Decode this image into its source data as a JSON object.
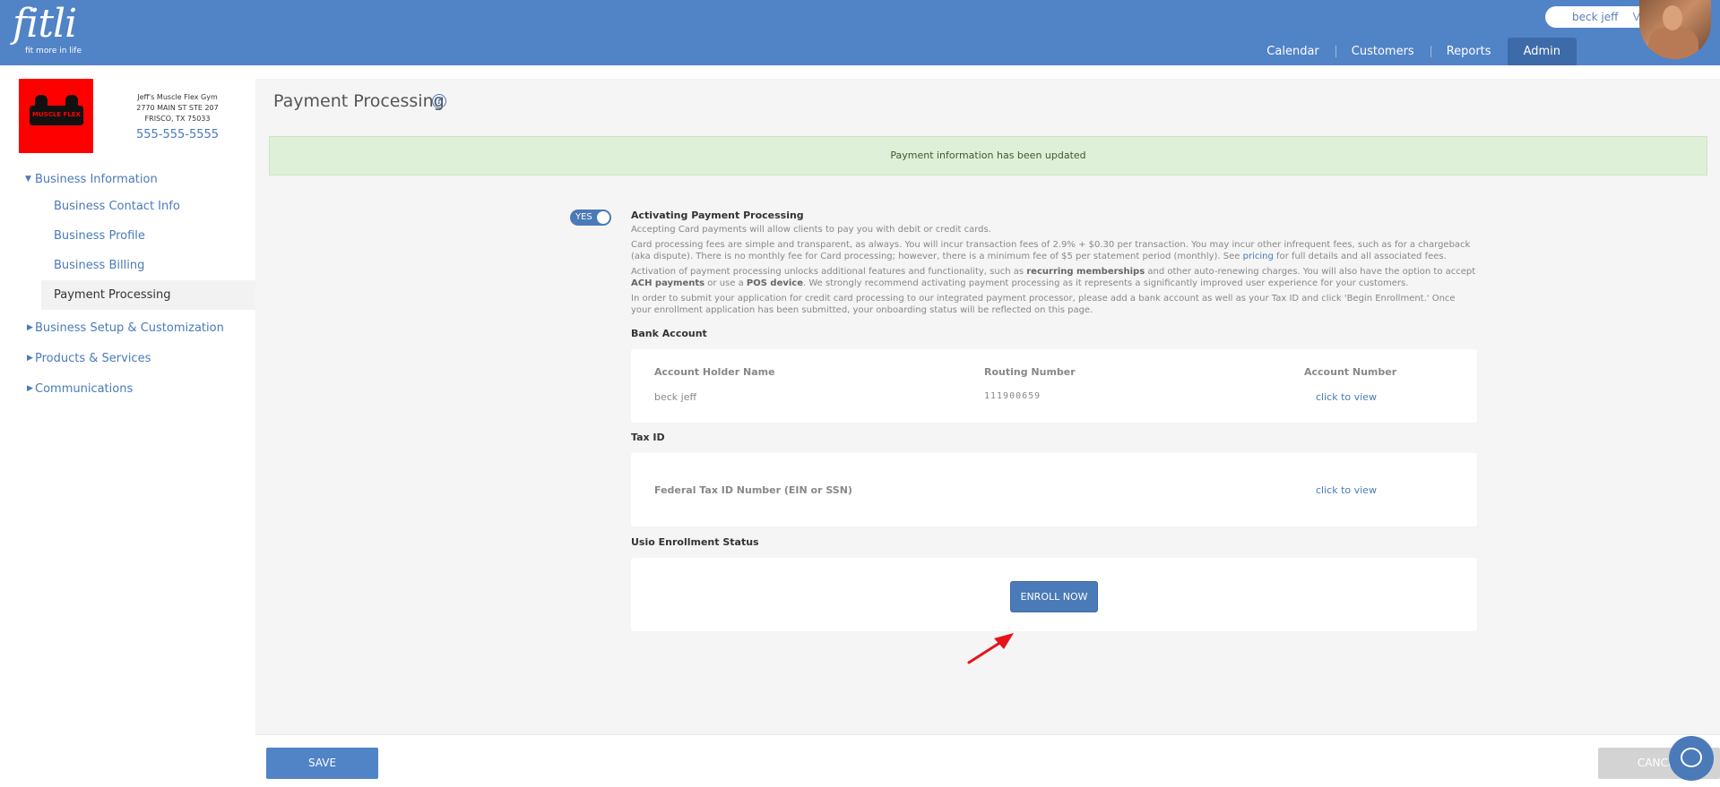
{
  "header": {
    "logo_text": "fitli",
    "logo_tagline": "fit more in life",
    "user_name": "beck jeff",
    "nav": [
      "Calendar",
      "Customers",
      "Reports",
      "Admin"
    ],
    "active_nav": "Admin"
  },
  "gym": {
    "logo_text": "MUSCLE FLEX",
    "name": "Jeff's Muscle Flex Gym",
    "address1": "2770 MAIN ST STE 207",
    "address2": "FRISCO, TX 75033",
    "phone": "555-555-5555"
  },
  "sidebar": {
    "groups": [
      {
        "label": "Business Information",
        "expanded": true,
        "items": [
          "Business Contact Info",
          "Business Profile",
          "Business Billing",
          "Payment Processing"
        ]
      },
      {
        "label": "Business Setup & Customization",
        "expanded": false
      },
      {
        "label": "Products & Services",
        "expanded": false
      },
      {
        "label": "Communications",
        "expanded": false
      }
    ],
    "active_item": "Payment Processing"
  },
  "main": {
    "title": "Payment Processing",
    "help_icon": "?",
    "alert": "Payment information has been updated",
    "toggle_label": "YES",
    "activating_title": "Activating Payment Processing",
    "para1": "Accepting Card payments will allow clients to pay you with debit or credit cards.",
    "para2_a": "Card processing fees are simple and transparent, as always. You will incur transaction fees of 2.9% + $0.30 per transaction. You may incur other infrequent fees, such as for a chargeback (aka dispute). There is no monthly fee for Card processing; however, there is a minimum fee of $5 per statement period (monthly). See ",
    "para2_link": "pricing",
    "para2_b": " for full details and all associated fees.",
    "para3_a": "Activation of payment processing unlocks additional features and functionality, such as ",
    "para3_b1": "recurring memberships",
    "para3_c": " and other auto-renewing charges. You will also have the option to accept ",
    "para3_b2": "ACH payments",
    "para3_d": " or use a ",
    "para3_b3": "POS device",
    "para3_e": ". We strongly recommend activating payment processing as it represents a significantly improved user experience for your customers.",
    "para4": "In order to submit your application for credit card processing to our integrated payment processor, please add a bank account as well as your Tax ID and click 'Begin Enrollment.' Once your enrollment application has been submitted, your onboarding status will be reflected on this page.",
    "bank_title": "Bank Account",
    "bank": {
      "headers": [
        "Account Holder Name",
        "Routing Number",
        "Account Number"
      ],
      "holder": "beck jeff",
      "routing": "111900659",
      "account_link": "click to view"
    },
    "tax_title": "Tax ID",
    "tax": {
      "label": "Federal Tax ID Number (EIN or SSN)",
      "link": "click to view"
    },
    "enroll_title": "Usio Enrollment Status",
    "enroll_button": "ENROLL NOW"
  },
  "footer": {
    "save": "SAVE",
    "cancel": "CANCEL"
  },
  "colors": {
    "header": "#5183c7",
    "accent": "#4a7ab8",
    "alert_bg": "#dff0d8",
    "arrow": "#e8121a"
  },
  "icons": [
    "help-icon",
    "chevron-down-icon",
    "caret-down-icon",
    "caret-right-icon",
    "chat-icon",
    "red-arrow-annotation"
  ]
}
